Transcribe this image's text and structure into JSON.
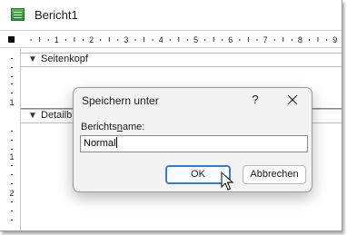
{
  "window": {
    "title": "Bericht1",
    "icon": "report-icon"
  },
  "ruler": {
    "labels": [
      "1",
      "2",
      "3",
      "4",
      "5",
      "6",
      "7",
      "8",
      "9"
    ]
  },
  "vruler": {
    "labels": [
      "1",
      "1",
      "2"
    ]
  },
  "sections": {
    "page_header": {
      "label": "Seitenkopf"
    },
    "detail": {
      "label": "Detailb"
    }
  },
  "dialog": {
    "title": "Speichern unter",
    "help": "?",
    "field_label_before": "Berichts",
    "field_label_underlined": "n",
    "field_label_after": "ame:",
    "field_value": "Normal",
    "ok_label": "OK",
    "cancel_label": "Abbrechen"
  }
}
